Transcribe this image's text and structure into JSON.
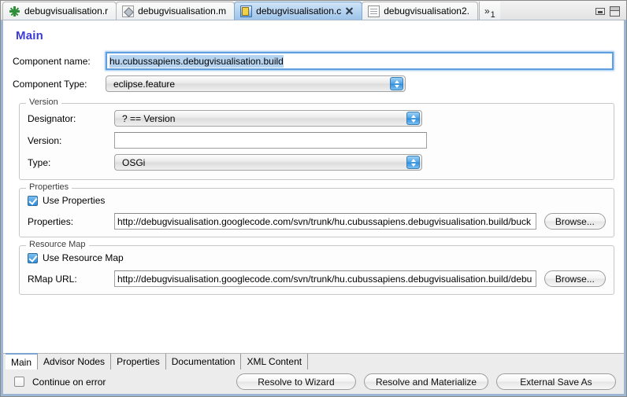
{
  "window": {
    "minimize_label": "Minimize",
    "maximize_label": "Maximize"
  },
  "editor_tabs": {
    "overflow_chevron": "»",
    "overflow_count": "1",
    "items": [
      {
        "label": "debugvisualisation.r",
        "icon": "asterisk-icon",
        "active": false,
        "closable": false
      },
      {
        "label": "debugvisualisation.m",
        "icon": "diamond-page-icon",
        "active": false,
        "closable": false
      },
      {
        "label": "debugvisualisation.c",
        "icon": "cquery-document-icon",
        "active": true,
        "closable": true
      },
      {
        "label": "debugvisualisation2.",
        "icon": "page-icon",
        "active": false,
        "closable": false
      }
    ]
  },
  "form": {
    "title": "Main",
    "component_name": {
      "label": "Component name:",
      "value": "hu.cubussapiens.debugvisualisation.build"
    },
    "component_type": {
      "label": "Component Type:",
      "value": "eclipse.feature"
    },
    "version_group": {
      "title": "Version",
      "designator": {
        "label": "Designator:",
        "value": "? == Version"
      },
      "version": {
        "label": "Version:",
        "value": "",
        "placeholder": ""
      },
      "type": {
        "label": "Type:",
        "value": "OSGi"
      }
    },
    "properties_group": {
      "title": "Properties",
      "use_checkbox": {
        "label": "Use Properties",
        "checked": true
      },
      "url": {
        "label": "Properties:",
        "value": "http://debugvisualisation.googlecode.com/svn/trunk/hu.cubussapiens.debugvisualisation.build/buck"
      },
      "browse_label": "Browse..."
    },
    "resource_map_group": {
      "title": "Resource Map",
      "use_checkbox": {
        "label": "Use Resource Map",
        "checked": true
      },
      "url": {
        "label": "RMap URL:",
        "value": "http://debugvisualisation.googlecode.com/svn/trunk/hu.cubussapiens.debugvisualisation.build/debu"
      },
      "browse_label": "Browse..."
    }
  },
  "page_tabs": [
    {
      "label": "Main",
      "active": true
    },
    {
      "label": "Advisor Nodes",
      "active": false
    },
    {
      "label": "Properties",
      "active": false
    },
    {
      "label": "Documentation",
      "active": false
    },
    {
      "label": "XML Content",
      "active": false
    }
  ],
  "footer": {
    "continue_on_error": {
      "label": "Continue on error",
      "checked": false
    },
    "buttons": [
      {
        "label": "Resolve to Wizard"
      },
      {
        "label": "Resolve and Materialize"
      },
      {
        "label": "External Save As"
      }
    ]
  },
  "colors": {
    "title_blue": "#3b3bd6",
    "accent_border": "#9bb7d4",
    "active_tab_blue": "#9dc4ea",
    "selection_blue": "#b6d4f0",
    "checkbox_blue": "#2f8ddb"
  }
}
